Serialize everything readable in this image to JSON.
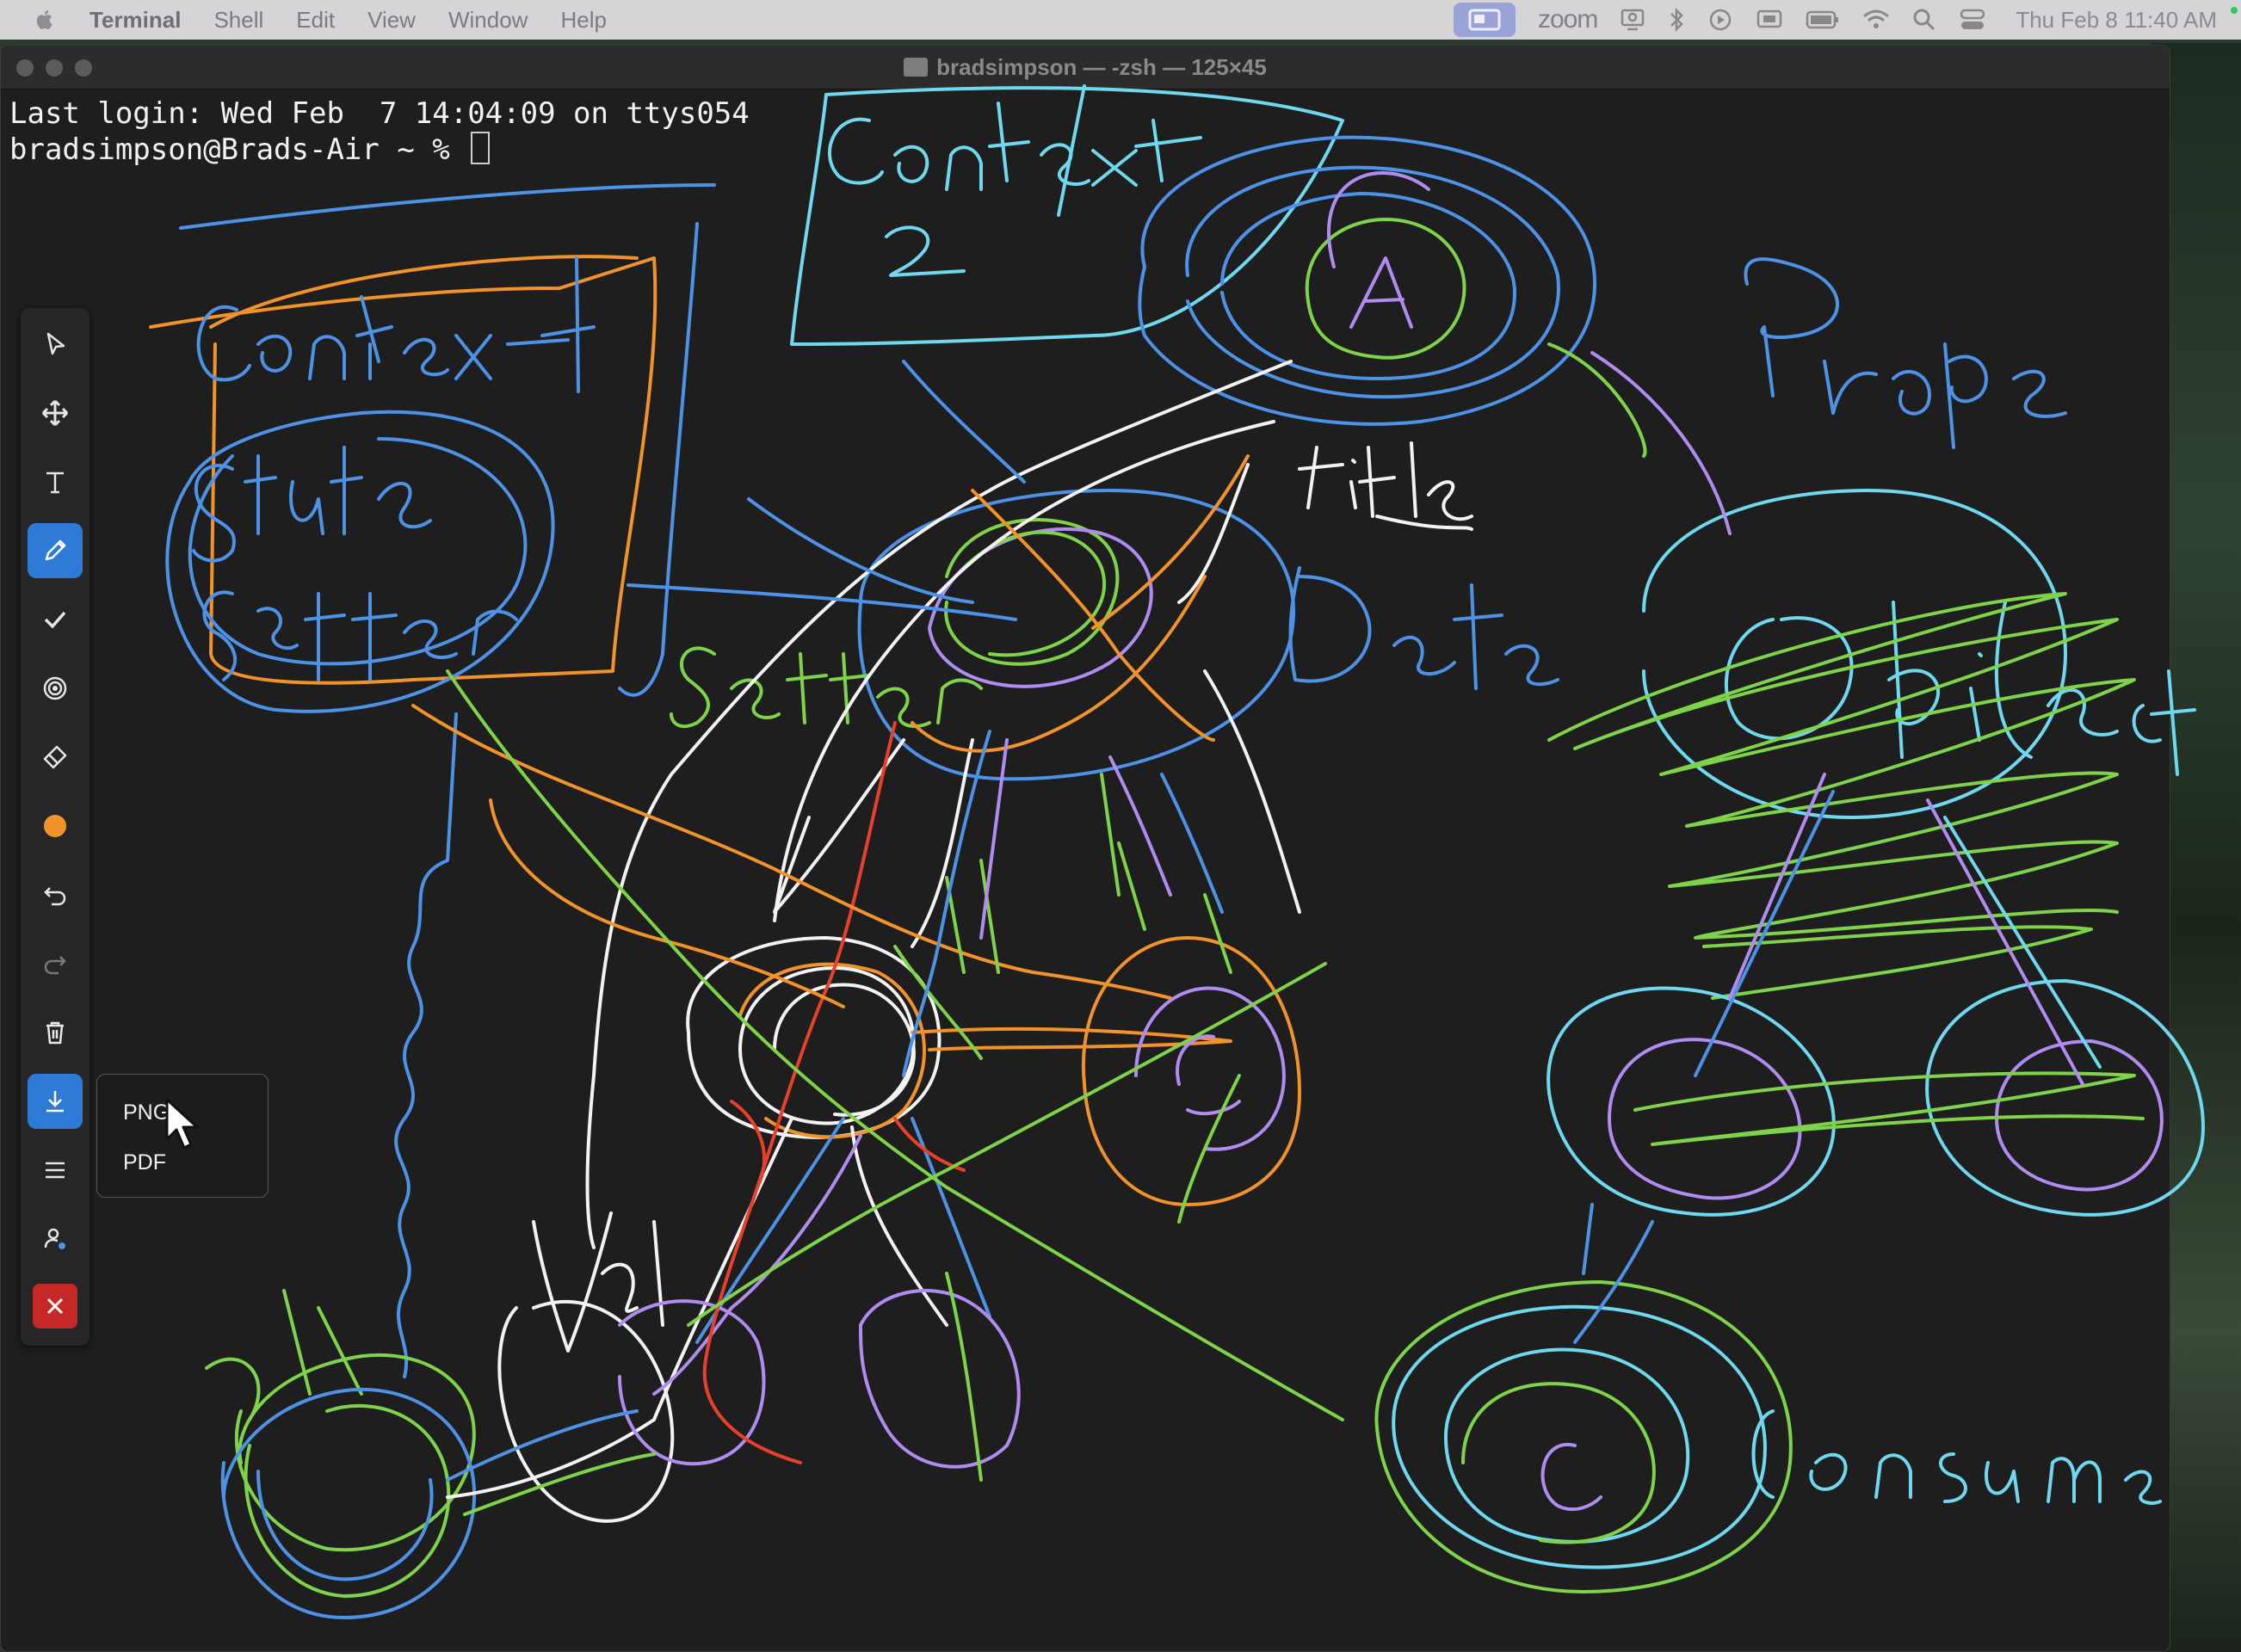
{
  "menubar": {
    "app_name": "Terminal",
    "menus": [
      "Shell",
      "Edit",
      "View",
      "Window",
      "Help"
    ],
    "zoom_label": "zoom",
    "clock": "Thu Feb 8  11:40 AM"
  },
  "window": {
    "title": "bradsimpson — -zsh — 125×45"
  },
  "terminal": {
    "line1": "Last login: Wed Feb  7 14:04:09 on ttys054",
    "prompt": "bradsimpson@Brads-Air ~ % "
  },
  "toolbar": {
    "tools": [
      "select",
      "move",
      "text",
      "draw",
      "stamp",
      "spotlight",
      "eraser",
      "color",
      "undo",
      "redo",
      "clear",
      "save",
      "more",
      "request-annotate",
      "close"
    ],
    "active_tool": "draw",
    "active_color": "#f2922a"
  },
  "save_menu": {
    "options": [
      "PNG",
      "PDF"
    ]
  },
  "annotations": {
    "words": [
      "Context",
      "State",
      "Setter",
      "Context 2",
      "A",
      "title",
      "Props",
      "Data",
      "Setter",
      "Object",
      "Consume",
      "Store",
      "Val"
    ]
  }
}
